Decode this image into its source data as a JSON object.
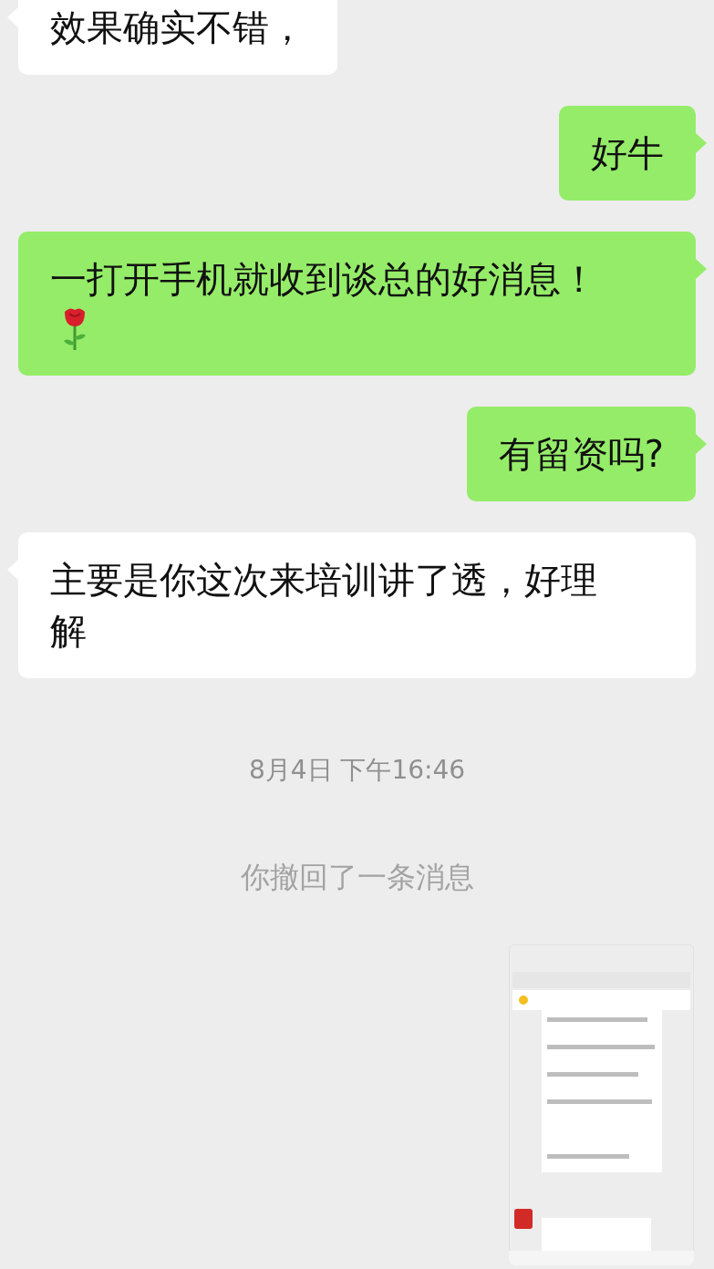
{
  "messages": [
    {
      "kind": "text",
      "outgoing": false,
      "text": "效果确实不错，"
    },
    {
      "kind": "text",
      "outgoing": true,
      "text": "好牛"
    },
    {
      "kind": "text_emoji",
      "outgoing": true,
      "text": "一打开手机就收到谈总的好消息！"
    },
    {
      "kind": "text",
      "outgoing": true,
      "text": "有留资吗?"
    },
    {
      "kind": "text",
      "outgoing": false,
      "text": "主要是你这次来培训讲了透，好理解"
    },
    {
      "kind": "timestamp",
      "text": "8月4日 下午16:46"
    },
    {
      "kind": "system",
      "text": "你撤回了一条消息"
    },
    {
      "kind": "picture"
    }
  ]
}
